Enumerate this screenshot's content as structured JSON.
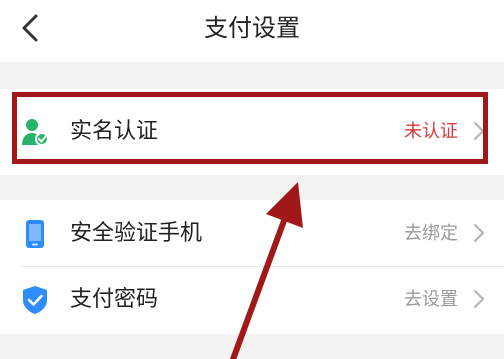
{
  "header": {
    "title": "支付设置"
  },
  "rows": [
    {
      "label": "实名认证",
      "value": "未认证",
      "value_color": "#d33a3a"
    },
    {
      "label": "安全验证手机",
      "value": "去绑定"
    },
    {
      "label": "支付密码",
      "value": "去设置"
    }
  ],
  "colors": {
    "highlight": "#a01818",
    "icon_green": "#27b36a",
    "icon_blue": "#2e8cff"
  }
}
